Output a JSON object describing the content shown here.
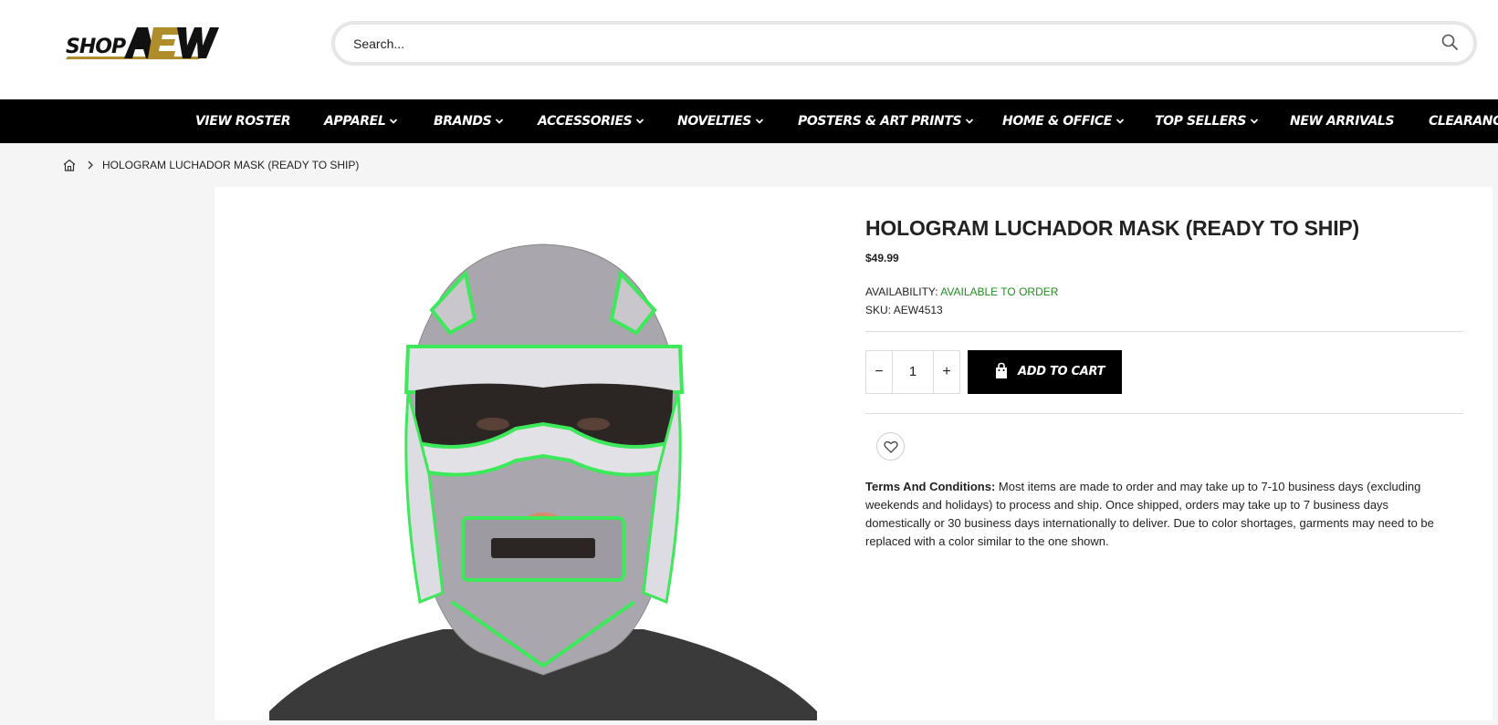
{
  "header": {
    "logo_text_shop": "SHOP",
    "logo_text_aew": "AEW",
    "search_placeholder": "Search..."
  },
  "nav": {
    "items": [
      {
        "label": "VIEW ROSTER",
        "has_dropdown": false
      },
      {
        "label": "APPAREL",
        "has_dropdown": true
      },
      {
        "label": "BRANDS",
        "has_dropdown": true
      },
      {
        "label": "ACCESSORIES",
        "has_dropdown": true
      },
      {
        "label": "NOVELTIES",
        "has_dropdown": true
      },
      {
        "label": "POSTERS & ART PRINTS",
        "has_dropdown": true
      },
      {
        "label": "HOME & OFFICE",
        "has_dropdown": true
      },
      {
        "label": "TOP SELLERS",
        "has_dropdown": true
      },
      {
        "label": "NEW ARRIVALS",
        "has_dropdown": false
      },
      {
        "label": "CLEARANC",
        "has_dropdown": false
      }
    ]
  },
  "breadcrumb": {
    "current": "HOLOGRAM LUCHADOR MASK (READY TO SHIP)"
  },
  "product": {
    "title": "HOLOGRAM LUCHADOR MASK (READY TO SHIP)",
    "price": "$49.99",
    "availability_label": "AVAILABILITY:",
    "availability_value": "AVAILABLE TO ORDER",
    "sku_label": "SKU:",
    "sku_value": "AEW4513",
    "quantity": "1",
    "add_to_cart_label": "ADD TO CART",
    "terms_heading": "Terms And Conditions:",
    "terms_text": "Most items are made to order and may take up to 7-10 business days (excluding weekends and holidays) to process and ship. Once shipped, orders may take up to 7 business days domestically or 30 business days internationally to deliver. Due to color shortages, garments may need to be replaced with a color similar to the one shown."
  },
  "colors": {
    "nav_bg": "#000000",
    "available": "#1f8f1f",
    "logo_gold": "#b08d2b",
    "mask_green": "#3de85a"
  }
}
